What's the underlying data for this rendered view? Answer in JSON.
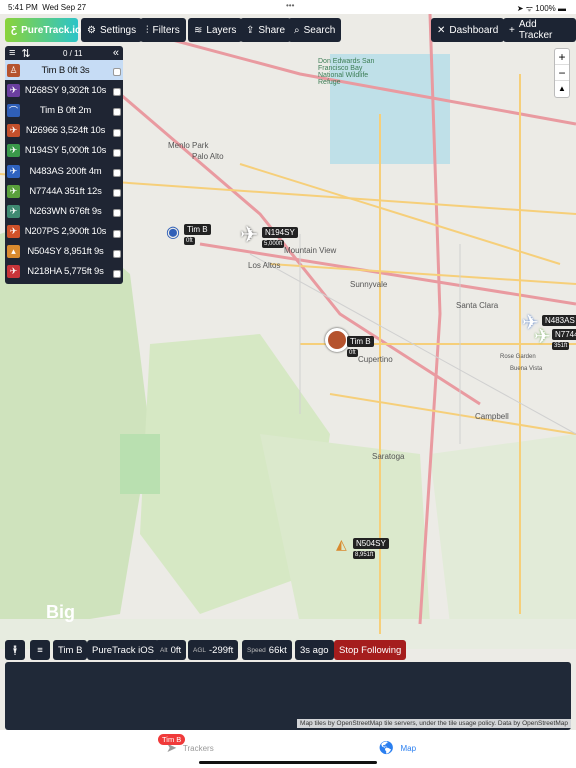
{
  "status": {
    "time": "5:41 PM",
    "date": "Wed Sep 27",
    "dots": "•••",
    "right": "➤ ᯤ 100% ▬"
  },
  "toolbar": {
    "logo": "PureTrack.io",
    "settings": "Settings",
    "filters": "Filters",
    "layers": "Layers",
    "share": "Share",
    "search": "Search",
    "dashboard": "Dashboard",
    "add_tracker": "Add Tracker"
  },
  "panel": {
    "count": "0 / 11",
    "rows": [
      {
        "name": "Tim B",
        "alt": "0ft",
        "age": "3s",
        "color": "#b5532e",
        "icon": "person-icon",
        "selected": true
      },
      {
        "name": "N268SY",
        "alt": "9,302ft",
        "age": "10s",
        "color": "#6b3fa0",
        "icon": "plane-icon"
      },
      {
        "name": "Tim B",
        "alt": "0ft",
        "age": "2m",
        "color": "#2f5fb8",
        "icon": "paraglider-icon"
      },
      {
        "name": "N26966",
        "alt": "3,524ft",
        "age": "10s",
        "color": "#c4502c",
        "icon": "plane-icon"
      },
      {
        "name": "N194SY",
        "alt": "5,000ft",
        "age": "10s",
        "color": "#3a9a4a",
        "icon": "plane-icon"
      },
      {
        "name": "N483AS",
        "alt": "200ft",
        "age": "4m",
        "color": "#2f63c0",
        "icon": "plane-icon"
      },
      {
        "name": "N7744A",
        "alt": "351ft",
        "age": "12s",
        "color": "#5aa03c",
        "icon": "plane-icon"
      },
      {
        "name": "N263WN",
        "alt": "676ft",
        "age": "9s",
        "color": "#3f8a72",
        "icon": "plane-icon"
      },
      {
        "name": "N207PS",
        "alt": "2,900ft",
        "age": "10s",
        "color": "#d0522a",
        "icon": "plane-icon"
      },
      {
        "name": "N504SY",
        "alt": "8,951ft",
        "age": "9s",
        "color": "#d98a2e",
        "icon": "glider-icon"
      },
      {
        "name": "N218HA",
        "alt": "5,775ft",
        "age": "9s",
        "color": "#c8353a",
        "icon": "plane-icon"
      }
    ]
  },
  "map": {
    "places": [
      "Don Edwards San Francisco Bay National Wildlife Refuge",
      "Menlo Park",
      "Palo Alto",
      "Mountain View",
      "Los Altos",
      "Sunnyvale",
      "Santa Clara",
      "Cupertino",
      "Rose Garden",
      "Campbell",
      "Saratoga",
      "Buena Vista",
      "Big"
    ],
    "markers": [
      {
        "label": "Tim B",
        "sub": "0ft"
      },
      {
        "label": "N194SY",
        "sub": "5,000ft"
      },
      {
        "label": "Tim B",
        "sub": "0ft"
      },
      {
        "label": "N483AS"
      },
      {
        "label": "N7744",
        "sub": "351ft"
      },
      {
        "label": "N504SY",
        "sub": "8,951ft"
      }
    ],
    "zoom_in": "+",
    "zoom_out": "−",
    "compass": "▲"
  },
  "bottom": {
    "name": "Tim B",
    "source": "PureTrack iOS",
    "alt_label": "Alt",
    "alt": "0ft",
    "agl_label": "AGL",
    "agl": "-299ft",
    "speed_label": "Speed",
    "speed": "66kt",
    "ago": "3s ago",
    "stop": "Stop Following",
    "stop_color": "#a51d1d"
  },
  "attribution": "Map tiles by OpenStreetMap tile servers, under the tile usage policy. Data by OpenStreetMap",
  "tabs": {
    "badge": "Tim B",
    "trackers": "Trackers",
    "map": "Map",
    "active_color": "#2a7ff0"
  }
}
